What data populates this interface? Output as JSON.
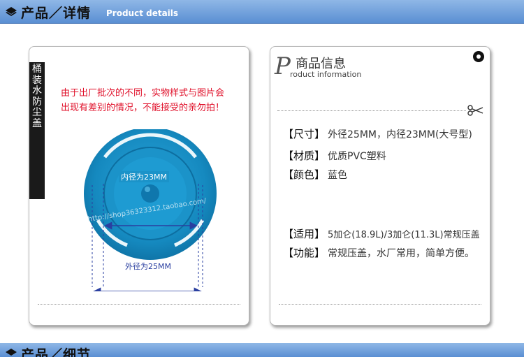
{
  "header": {
    "title": "产品／详情",
    "subtitle": "Product details"
  },
  "left_panel": {
    "side_label": "桶装水防尘盖",
    "notice_line1": "由于出厂批次的不同，实物样式与图片会",
    "notice_line2": "出现有差别的情况，不能接受的亲勿拍！",
    "inner_label": "内径为23MM",
    "outer_label": "外径为25MM",
    "watermark": "http://shop36323312.taobao.com/",
    "product_color": "#1a8fc4"
  },
  "right_panel": {
    "title_letter": "P",
    "title_cn": "商品信息",
    "title_en": "roduct information",
    "specs": [
      {
        "label": "【尺寸】",
        "value": "外径25MM，内径23MM(大号型)"
      },
      {
        "label": "【材质】",
        "value": "优质PVC塑料"
      },
      {
        "label": "【颜色】",
        "value": "蓝色"
      },
      {
        "label": "【适用】",
        "value": "5加仑(18.9L)/3加仑(11.3L)常规压盖"
      },
      {
        "label": "【功能】",
        "value": "常规压盖，水厂常用，简单方便。"
      }
    ]
  },
  "footer_header": {
    "title": "产品／细节"
  },
  "colors": {
    "header_blue": "#6b9bd8",
    "notice_red": "#e0102a"
  }
}
